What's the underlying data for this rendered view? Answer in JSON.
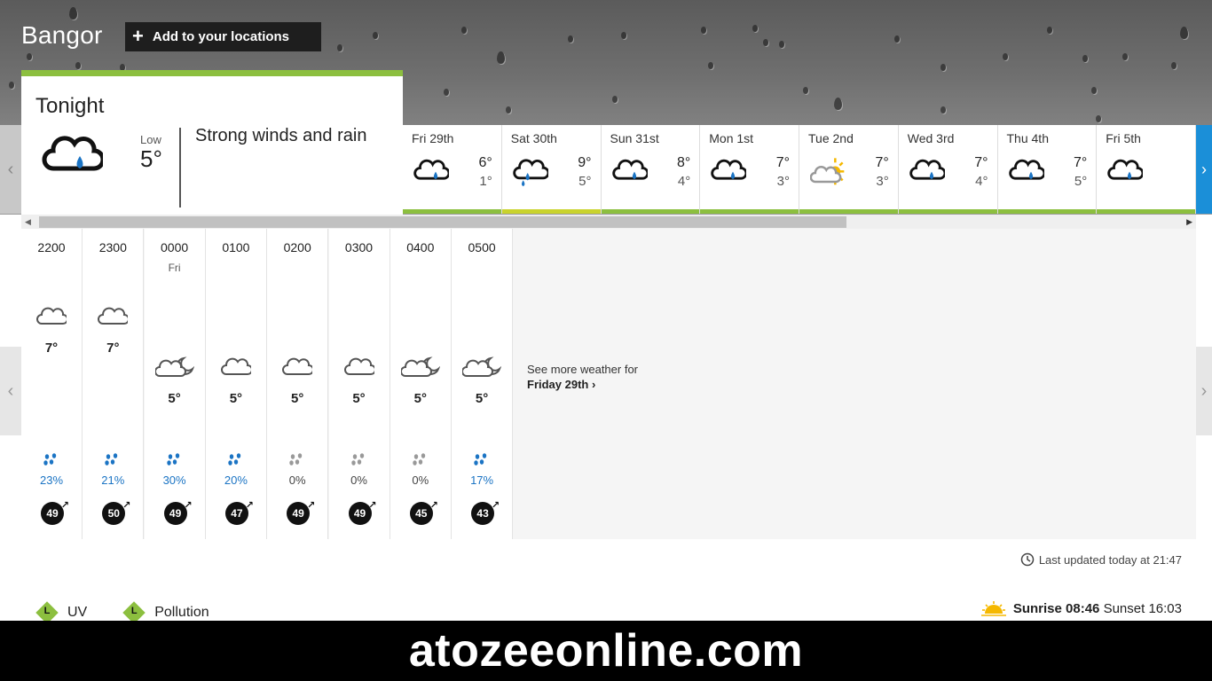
{
  "header": {
    "location": "Bangor",
    "add_location_label": "Add to your locations"
  },
  "tonight": {
    "title": "Tonight",
    "low_label": "Low",
    "low_value": "5°",
    "description": "Strong winds and rain",
    "icon": "heavy-rain-cloud-icon",
    "accent": "#8cbf3f"
  },
  "days": [
    {
      "name": "Fri 29th",
      "high": "6°",
      "low": "1°",
      "icon": "rain-cloud-icon",
      "bar": "#8cbf3f"
    },
    {
      "name": "Sat 30th",
      "high": "9°",
      "low": "5°",
      "icon": "heavy-rain-cloud-icon",
      "bar": "#c9d32d"
    },
    {
      "name": "Sun 31st",
      "high": "8°",
      "low": "4°",
      "icon": "rain-cloud-icon",
      "bar": "#8cbf3f"
    },
    {
      "name": "Mon 1st",
      "high": "7°",
      "low": "3°",
      "icon": "rain-cloud-icon",
      "bar": "#8cbf3f"
    },
    {
      "name": "Tue 2nd",
      "high": "7°",
      "low": "3°",
      "icon": "sun-cloud-icon",
      "bar": "#8cbf3f"
    },
    {
      "name": "Wed 3rd",
      "high": "7°",
      "low": "4°",
      "icon": "rain-cloud-icon",
      "bar": "#8cbf3f"
    },
    {
      "name": "Thu 4th",
      "high": "7°",
      "low": "5°",
      "icon": "rain-cloud-icon",
      "bar": "#8cbf3f"
    },
    {
      "name": "Fri 5th",
      "high": "",
      "low": "",
      "icon": "rain-cloud-icon",
      "bar": "#8cbf3f"
    }
  ],
  "hours": [
    {
      "time": "2200",
      "sub": "",
      "icon": "cloud-icon",
      "temp": "7°",
      "rain": "23%",
      "rain_color": "#1b74c4",
      "wind": "49"
    },
    {
      "time": "2300",
      "sub": "",
      "icon": "cloud-icon",
      "temp": "7°",
      "rain": "21%",
      "rain_color": "#1b74c4",
      "wind": "50"
    },
    {
      "time": "0000",
      "sub": "Fri",
      "icon": "cloud-moon-icon",
      "temp": "5°",
      "rain": "30%",
      "rain_color": "#1b74c4",
      "wind": "49"
    },
    {
      "time": "0100",
      "sub": "",
      "icon": "cloud-icon",
      "temp": "5°",
      "rain": "20%",
      "rain_color": "#1b74c4",
      "wind": "47"
    },
    {
      "time": "0200",
      "sub": "",
      "icon": "cloud-icon",
      "temp": "5°",
      "rain": "0%",
      "rain_color": "#444444",
      "wind": "49"
    },
    {
      "time": "0300",
      "sub": "",
      "icon": "cloud-icon",
      "temp": "5°",
      "rain": "0%",
      "rain_color": "#444444",
      "wind": "49"
    },
    {
      "time": "0400",
      "sub": "",
      "icon": "cloud-moon-icon",
      "temp": "5°",
      "rain": "0%",
      "rain_color": "#444444",
      "wind": "45"
    },
    {
      "time": "0500",
      "sub": "",
      "icon": "cloud-moon-icon",
      "temp": "5°",
      "rain": "17%",
      "rain_color": "#1b74c4",
      "wind": "43"
    }
  ],
  "see_more": {
    "line1": "See more weather for",
    "line2": "Friday 29th"
  },
  "updated": "Last updated today at 21:47",
  "uv": {
    "label": "UV",
    "level": "L"
  },
  "pollution": {
    "label": "Pollution",
    "level": "L"
  },
  "sun": {
    "sunrise_label": "Sunrise",
    "sunrise": "08:46",
    "sunset_label": "Sunset",
    "sunset": "16:03"
  },
  "footer": {
    "text": "atozeeonline.com"
  },
  "nav": {
    "next": "›",
    "prev": "‹"
  }
}
